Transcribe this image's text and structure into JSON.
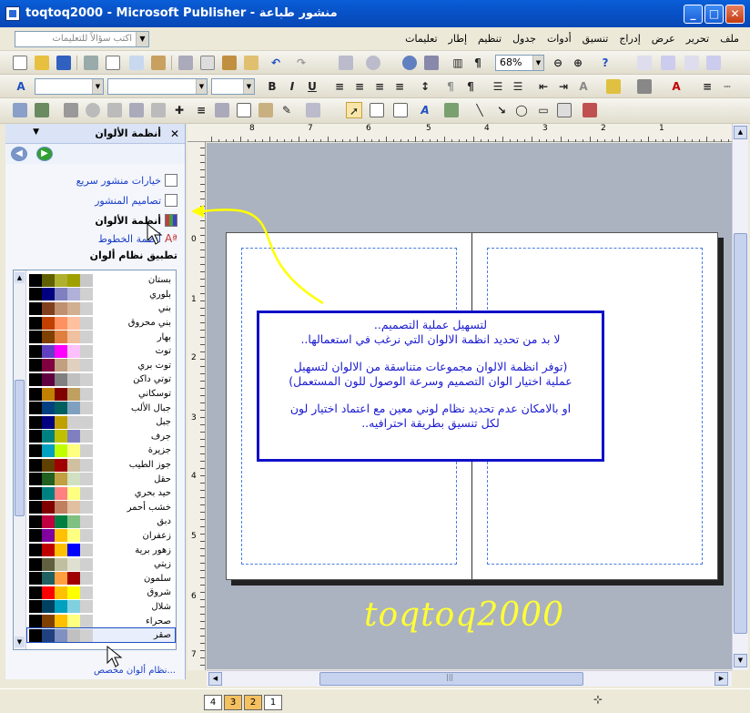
{
  "window": {
    "title": "toqtoq2000 - Microsoft Publisher - منشور طباعة",
    "minimize": "_",
    "maximize": "□",
    "close": "✕"
  },
  "menubar": {
    "ask_placeholder": "اكتب سؤالاً للتعليمات",
    "menus": [
      "ملف",
      "تحرير",
      "عرض",
      "إدراج",
      "تنسيق",
      "أدوات",
      "جدول",
      "تنظيم",
      "إطار",
      "تعليمات"
    ]
  },
  "toolbar_standard": {
    "zoom": "68%"
  },
  "taskpane": {
    "title": "أنظمة الألوان",
    "links": [
      "خيارات منشور سريع",
      "تصاميم المنشور",
      "أنظمة الألوان",
      "أنظمة الخطوط"
    ],
    "apply_heading": "تطبيق نظام ألوان",
    "custom_link": "نظام ألوان مخصص...",
    "selected": "صقر",
    "schemes": [
      {
        "name": "بستان",
        "colors": [
          "#000000",
          "#606000",
          "#b0b030",
          "#a0a000",
          "#c8c8c8"
        ]
      },
      {
        "name": "بلوري",
        "colors": [
          "#000000",
          "#000080",
          "#8080c0",
          "#b0b0d8",
          "#d0d0d0"
        ]
      },
      {
        "name": "بني",
        "colors": [
          "#000000",
          "#804020",
          "#c09070",
          "#d0b090",
          "#d0d0d0"
        ]
      },
      {
        "name": "بني محروق",
        "colors": [
          "#000000",
          "#c04000",
          "#ff9060",
          "#ffc0a0",
          "#d0d0d0"
        ]
      },
      {
        "name": "بهار",
        "colors": [
          "#000000",
          "#804000",
          "#e08040",
          "#f0c0a0",
          "#d0d0d0"
        ]
      },
      {
        "name": "توت",
        "colors": [
          "#000000",
          "#6040c0",
          "#ff00ff",
          "#ffc0ff",
          "#d0d0d0"
        ]
      },
      {
        "name": "توت بري",
        "colors": [
          "#000000",
          "#800040",
          "#c0a080",
          "#e0d0c0",
          "#d0d0d0"
        ]
      },
      {
        "name": "توتي داكن",
        "colors": [
          "#000000",
          "#600040",
          "#808080",
          "#c0c0c0",
          "#d0d0d0"
        ]
      },
      {
        "name": "توسكاني",
        "colors": [
          "#000000",
          "#c08000",
          "#800000",
          "#c0a060",
          "#d0d0d0"
        ]
      },
      {
        "name": "جبال الألب",
        "colors": [
          "#000000",
          "#004080",
          "#006060",
          "#80a0c0",
          "#d0d0d0"
        ]
      },
      {
        "name": "جبل",
        "colors": [
          "#000000",
          "#000080",
          "#c0a000",
          "#d0d0d0",
          "#d0d0d0"
        ]
      },
      {
        "name": "جرف",
        "colors": [
          "#000000",
          "#008080",
          "#c0c000",
          "#8080c0",
          "#d0d0d0"
        ]
      },
      {
        "name": "جزيرة",
        "colors": [
          "#000000",
          "#00a0c0",
          "#c0ff00",
          "#ffff80",
          "#d0d0d0"
        ]
      },
      {
        "name": "جوز الطيب",
        "colors": [
          "#000000",
          "#604000",
          "#a00000",
          "#d0c0a0",
          "#d0d0d0"
        ]
      },
      {
        "name": "حقل",
        "colors": [
          "#000000",
          "#206020",
          "#c0a040",
          "#d0e0c0",
          "#d0d0d0"
        ]
      },
      {
        "name": "حيد بحري",
        "colors": [
          "#000000",
          "#008080",
          "#ff8080",
          "#ffff80",
          "#d0d0d0"
        ]
      },
      {
        "name": "خشب أحمر",
        "colors": [
          "#000000",
          "#800000",
          "#c08060",
          "#e0c0a0",
          "#d0d0d0"
        ]
      },
      {
        "name": "دبق",
        "colors": [
          "#000000",
          "#c00040",
          "#008040",
          "#80c080",
          "#d0d0d0"
        ]
      },
      {
        "name": "زعفران",
        "colors": [
          "#000000",
          "#8000a0",
          "#ffc000",
          "#ffff80",
          "#d0d0d0"
        ]
      },
      {
        "name": "زهور برية",
        "colors": [
          "#000000",
          "#c00000",
          "#ffc000",
          "#0000ff",
          "#d0d0d0"
        ]
      },
      {
        "name": "زيتي",
        "colors": [
          "#000000",
          "#606040",
          "#c0c0a0",
          "#e0e0d0",
          "#d0d0d0"
        ]
      },
      {
        "name": "سلمون",
        "colors": [
          "#000000",
          "#206060",
          "#ffa040",
          "#a00000",
          "#d0d0d0"
        ]
      },
      {
        "name": "شروق",
        "colors": [
          "#000000",
          "#ff0000",
          "#ffc000",
          "#ffff00",
          "#d0d0d0"
        ]
      },
      {
        "name": "شلال",
        "colors": [
          "#000000",
          "#004060",
          "#00a0c0",
          "#80d0e0",
          "#d0d0d0"
        ]
      },
      {
        "name": "صحراء",
        "colors": [
          "#000000",
          "#804000",
          "#ffc000",
          "#ffff80",
          "#d0d0d0"
        ]
      },
      {
        "name": "صقر",
        "colors": [
          "#000000",
          "#204080",
          "#8090c0",
          "#c0c0c0",
          "#d0d0d0"
        ]
      }
    ]
  },
  "rulers": {
    "horizontal": [
      "8",
      "7",
      "6",
      "5",
      "4",
      "3",
      "2",
      "1"
    ],
    "vertical": [
      "0",
      "1",
      "2",
      "3",
      "4",
      "5",
      "6",
      "7"
    ]
  },
  "callout": {
    "line1": "لتسهيل عملية التصميم..",
    "line2": "لا بد من تحديد انظمة الالوان التي نرغب في استعمالها..",
    "line3": "(توفر انظمة الالوان مجموعات متناسقة من الالوان لتسهيل",
    "line4": "عملية اختيار الوان التصميم وسرعة الوصول للون المستعمل)",
    "line5": "او بالامكان عدم تحديد نظام لوني معين مع اعتماد اختيار لون",
    "line6": "لكل تنسيق بطريقة احترافيه.."
  },
  "watermark": "toqtoq2000",
  "pages": [
    "4",
    "3",
    "2",
    "1"
  ],
  "colors": {
    "titlebar": "#0853c9",
    "callout_border": "#1010c8",
    "watermark": "#ffff33",
    "arrow": "#ffff00"
  }
}
